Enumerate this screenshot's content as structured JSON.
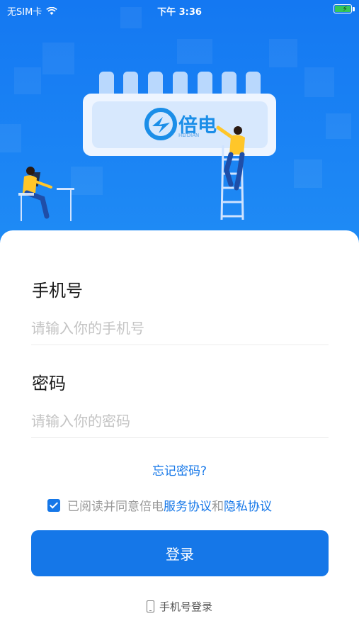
{
  "status_bar": {
    "carrier": "无SIM卡",
    "time": "下午 3:36",
    "icons": [
      "wifi-icon",
      "battery-icon"
    ],
    "battery_color": "#34c759"
  },
  "hero": {
    "logo_text": "倍电",
    "logo_subtext": "HEIDIAN",
    "background_color": "#1478f2"
  },
  "form": {
    "phone_label": "手机号",
    "phone_placeholder": "请输入你的手机号",
    "phone_value": "",
    "password_label": "密码",
    "password_placeholder": "请输入你的密码",
    "password_value": ""
  },
  "forgot_password": "忘记密码?",
  "agreement": {
    "checked": true,
    "prefix": "已阅读并同意倍电",
    "service_link": "服务协议",
    "joiner": "和",
    "privacy_link": "隐私协议"
  },
  "login_button": "登录",
  "phone_login": "手机号登录",
  "accent_color": "#1577e8"
}
